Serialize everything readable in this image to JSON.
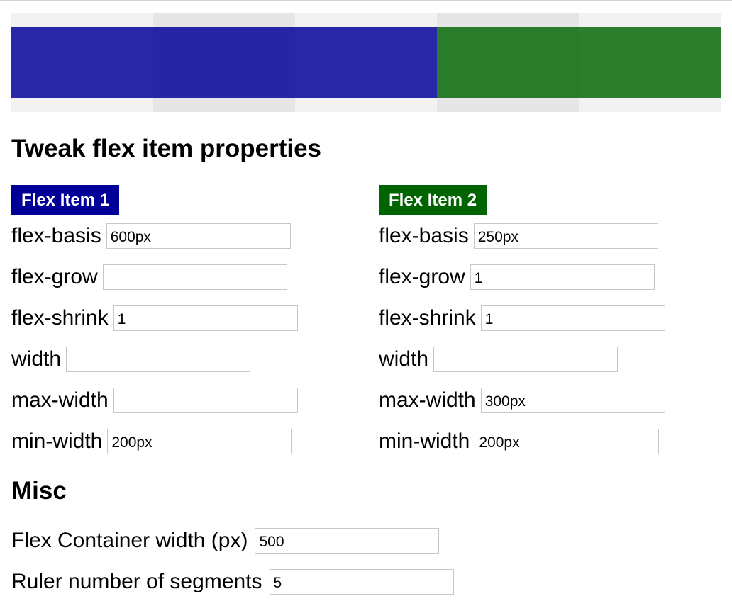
{
  "heading": "Tweak flex item properties",
  "colors": {
    "item1": "#000099",
    "item2": "#006400",
    "ruler_light": "#f2f2f2",
    "ruler_dark": "#e6e6e6"
  },
  "ruler": {
    "segments": 5
  },
  "items": [
    {
      "badge": "Flex Item 1",
      "fields": [
        {
          "label": "flex-basis",
          "value": "600px"
        },
        {
          "label": "flex-grow",
          "value": ""
        },
        {
          "label": "flex-shrink",
          "value": "1"
        },
        {
          "label": "width",
          "value": ""
        },
        {
          "label": "max-width",
          "value": ""
        },
        {
          "label": "min-width",
          "value": "200px"
        }
      ]
    },
    {
      "badge": "Flex Item 2",
      "fields": [
        {
          "label": "flex-basis",
          "value": "250px"
        },
        {
          "label": "flex-grow",
          "value": "1"
        },
        {
          "label": "flex-shrink",
          "value": "1"
        },
        {
          "label": "width",
          "value": ""
        },
        {
          "label": "max-width",
          "value": "300px"
        },
        {
          "label": "min-width",
          "value": "200px"
        }
      ]
    }
  ],
  "misc": {
    "heading": "Misc",
    "container_width": {
      "label": "Flex Container width (px)",
      "value": "500"
    },
    "ruler_segments": {
      "label": "Ruler number of segments",
      "value": "5"
    }
  }
}
